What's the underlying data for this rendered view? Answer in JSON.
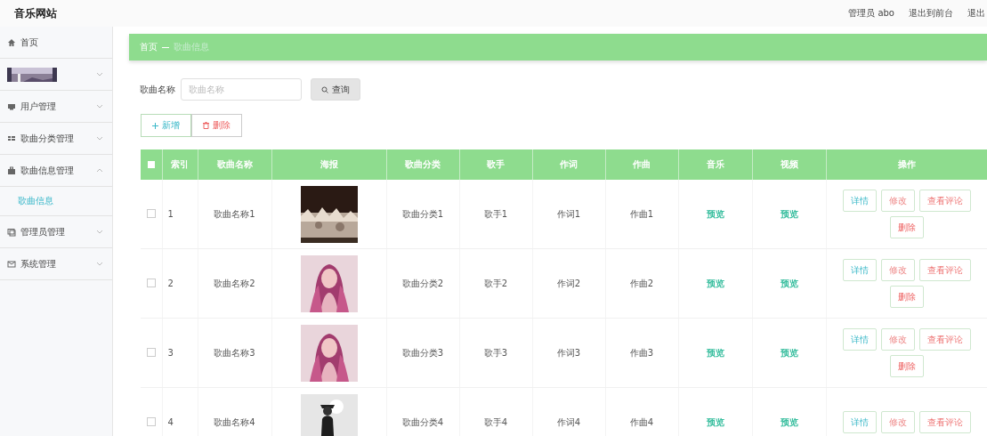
{
  "header": {
    "site_title": "音乐网站",
    "links": [
      {
        "label": "管理员 abo"
      },
      {
        "label": "退出到前台"
      },
      {
        "label": "退出"
      }
    ]
  },
  "sidebar": {
    "items": [
      {
        "kind": "link",
        "label": "首页"
      },
      {
        "kind": "picture",
        "expanded": false
      },
      {
        "kind": "menu",
        "label": "用户管理",
        "expanded": false
      },
      {
        "kind": "menu",
        "label": "歌曲分类管理",
        "expanded": false
      },
      {
        "kind": "menu",
        "label": "歌曲信息管理",
        "expanded": true,
        "children": [
          {
            "label": "歌曲信息",
            "selected": true
          }
        ]
      },
      {
        "kind": "menu",
        "label": "管理员管理",
        "expanded": false
      },
      {
        "kind": "menu",
        "label": "系统管理",
        "expanded": false
      }
    ]
  },
  "breadcrumb": [
    "首页",
    "歌曲信息"
  ],
  "search": {
    "label": "歌曲名称",
    "placeholder": "歌曲名称",
    "button": "查询"
  },
  "toolbar": [
    {
      "kind": "add",
      "label": "新增"
    },
    {
      "kind": "delete",
      "label": "删除"
    }
  ],
  "table": {
    "all_checked": false,
    "columns": [
      "索引",
      "歌曲名称",
      "海报",
      "歌曲分类",
      "歌手",
      "作词",
      "作曲",
      "音乐",
      "视频",
      "操作"
    ],
    "rows": [
      {
        "checked": false,
        "cells": [
          "1",
          "歌曲名称1",
          "",
          "歌曲分类1",
          "歌手1",
          "作词1",
          "作曲1",
          "预览",
          "预览"
        ],
        "actions": [
          "详情",
          "修改",
          "查看评论",
          "删除"
        ]
      },
      {
        "checked": false,
        "cells": [
          "2",
          "歌曲名称2",
          "",
          "歌曲分类2",
          "歌手2",
          "作词2",
          "作曲2",
          "预览",
          "预览"
        ],
        "actions": [
          "详情",
          "修改",
          "查看评论",
          "删除"
        ]
      },
      {
        "checked": false,
        "cells": [
          "3",
          "歌曲名称3",
          "",
          "歌曲分类3",
          "歌手3",
          "作词3",
          "作曲3",
          "预览",
          "预览"
        ],
        "actions": [
          "详情",
          "修改",
          "查看评论",
          "删除"
        ]
      },
      {
        "checked": false,
        "cells": [
          "4",
          "歌曲名称4",
          "",
          "歌曲分类4",
          "歌手4",
          "作词4",
          "作曲4",
          "预览",
          "预览"
        ],
        "actions": [
          "详情",
          "修改",
          "查看评论"
        ]
      }
    ]
  }
}
